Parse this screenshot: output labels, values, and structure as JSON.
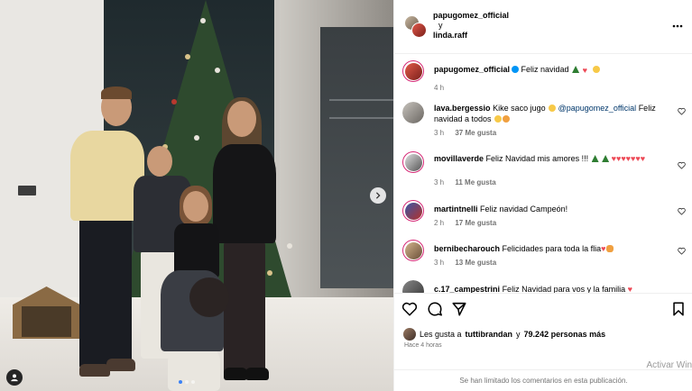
{
  "post": {
    "author_line1": "papugomez_official",
    "and_word": "y",
    "author_line2": "linda.raff"
  },
  "comments": [
    {
      "user": "papugomez_official",
      "text": "Feliz navidad",
      "time": "4 h",
      "likes": "",
      "verified": true
    },
    {
      "user": "lava.bergessio",
      "text": "Kike saco jugo",
      "mention": "@papugomez_official",
      "text2": "Feliz navidad a todos",
      "time": "3 h",
      "likes": "37 Me gusta"
    },
    {
      "user": "movillaverde",
      "text": "Feliz Navidad mis amores !!!",
      "time": "3 h",
      "likes": "11 Me gusta"
    },
    {
      "user": "martintnelli",
      "text": "Feliz navidad Campeón!",
      "time": "2 h",
      "likes": "17 Me gusta"
    },
    {
      "user": "bernibecharouch",
      "text": "Felicidades para toda la flia",
      "time": "3 h",
      "likes": "13 Me gusta"
    },
    {
      "user": "c.17_campestrini",
      "text": "Feliz Navidad para vos y la familia"
    }
  ],
  "likes_bar": {
    "prefix": "Les gusta a",
    "user": "tuttibrandan",
    "mid": "y",
    "count": "79.242 personas más"
  },
  "posted_ago": "Hace 4 horas",
  "comments_limited": "Se han limitado los comentarios en esta publicación.",
  "watermark": "Activar Win",
  "colors": {
    "link": "#00376b",
    "meta": "#737373",
    "verified": "#0095f6",
    "story_ring": "#d62976"
  },
  "icons": [
    "more-icon",
    "heart-icon",
    "comment-icon",
    "share-icon",
    "bookmark-icon",
    "chevron-right-icon",
    "user-tag-icon"
  ]
}
